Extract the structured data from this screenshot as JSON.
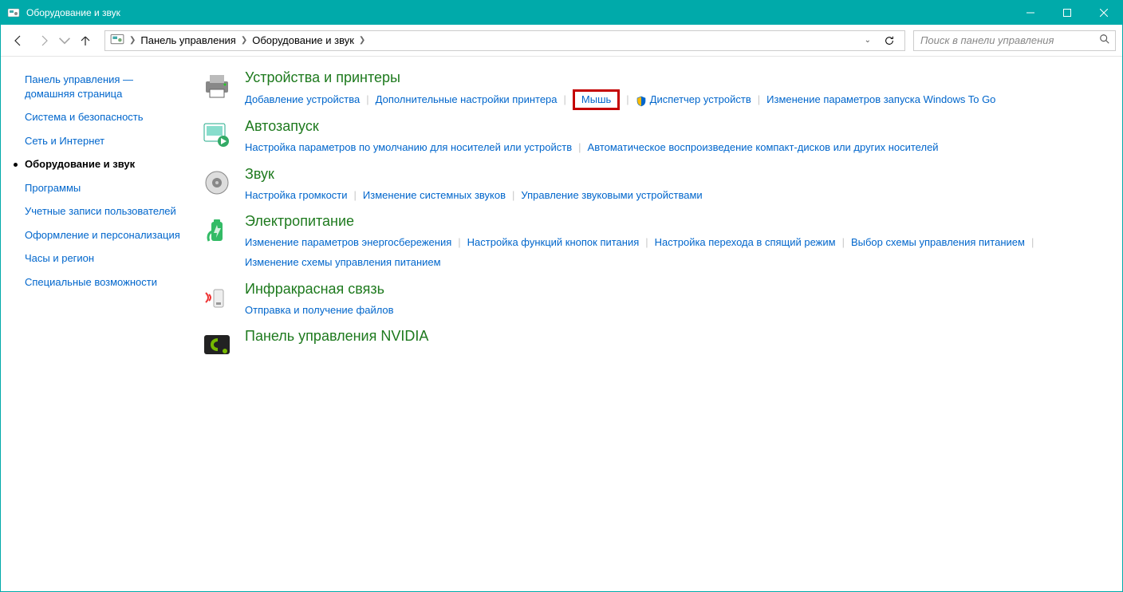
{
  "window": {
    "title": "Оборудование и звук"
  },
  "breadcrumb": {
    "root": "Панель управления",
    "current": "Оборудование и звук"
  },
  "search": {
    "placeholder": "Поиск в панели управления"
  },
  "sidebar": {
    "home": "Панель управления — домашняя страница",
    "items": [
      "Система и безопасность",
      "Сеть и Интернет",
      "Оборудование и звук",
      "Программы",
      "Учетные записи пользователей",
      "Оформление и персонализация",
      "Часы и регион",
      "Специальные возможности"
    ],
    "current_index": 2
  },
  "categories": [
    {
      "title": "Устройства и принтеры",
      "icon": "printer-icon",
      "links": [
        {
          "text": "Добавление устройства"
        },
        {
          "text": "Дополнительные настройки принтера"
        },
        {
          "text": "Мышь",
          "highlight": true
        },
        {
          "text": "Диспетчер устройств",
          "shield": true
        },
        {
          "text": "Изменение параметров запуска Windows To Go"
        }
      ]
    },
    {
      "title": "Автозапуск",
      "icon": "autoplay-icon",
      "links": [
        {
          "text": "Настройка параметров по умолчанию для носителей или устройств"
        },
        {
          "text": "Автоматическое воспроизведение компакт-дисков или других носителей"
        }
      ]
    },
    {
      "title": "Звук",
      "icon": "speaker-icon",
      "links": [
        {
          "text": "Настройка громкости"
        },
        {
          "text": "Изменение системных звуков"
        },
        {
          "text": "Управление звуковыми устройствами"
        }
      ]
    },
    {
      "title": "Электропитание",
      "icon": "battery-icon",
      "links": [
        {
          "text": "Изменение параметров энергосбережения"
        },
        {
          "text": "Настройка функций кнопок питания"
        },
        {
          "text": "Настройка перехода в спящий режим"
        },
        {
          "text": "Выбор схемы управления питанием"
        },
        {
          "text": "Изменение схемы управления питанием"
        }
      ]
    },
    {
      "title": "Инфракрасная связь",
      "icon": "infrared-icon",
      "links": [
        {
          "text": "Отправка и получение файлов"
        }
      ]
    },
    {
      "title": "Панель управления NVIDIA",
      "icon": "nvidia-icon",
      "links": []
    }
  ]
}
